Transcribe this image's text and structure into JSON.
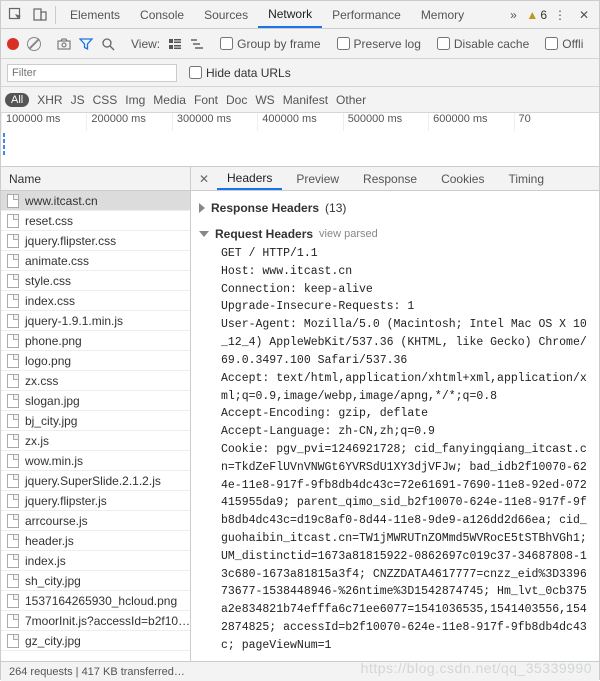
{
  "topTabs": [
    "Elements",
    "Console",
    "Sources",
    "Network",
    "Performance",
    "Memory"
  ],
  "activeTopTab": "Network",
  "warnCount": "6",
  "toolbar2": {
    "viewLabel": "View:",
    "groupByFrame": "Group by frame",
    "preserveLog": "Preserve log",
    "disableCache": "Disable cache",
    "offline": "Offli"
  },
  "filter": {
    "placeholder": "Filter",
    "hideData": "Hide data URLs"
  },
  "typeFilters": {
    "all": "All",
    "items": [
      "XHR",
      "JS",
      "CSS",
      "Img",
      "Media",
      "Font",
      "Doc",
      "WS",
      "Manifest",
      "Other"
    ]
  },
  "timelineTicks": [
    "100000 ms",
    "200000 ms",
    "300000 ms",
    "400000 ms",
    "500000 ms",
    "600000 ms",
    "70"
  ],
  "nameHeader": "Name",
  "files": [
    "www.itcast.cn",
    "reset.css",
    "jquery.flipster.css",
    "animate.css",
    "style.css",
    "index.css",
    "jquery-1.9.1.min.js",
    "phone.png",
    "logo.png",
    "zx.css",
    "slogan.jpg",
    "bj_city.jpg",
    "zx.js",
    "wow.min.js",
    "jquery.SuperSlide.2.1.2.js",
    "jquery.flipster.js",
    "arrcourse.js",
    "header.js",
    "index.js",
    "sh_city.jpg",
    "1537164265930_hcloud.png",
    "7moorInit.js?accessId=b2f10…",
    "gz_city.jpg"
  ],
  "selectedFile": "www.itcast.cn",
  "detailTabs": [
    "Headers",
    "Preview",
    "Response",
    "Cookies",
    "Timing"
  ],
  "activeDetailTab": "Headers",
  "responseHeaders": {
    "title": "Response Headers",
    "count": "(13)"
  },
  "requestHeaders": {
    "title": "Request Headers",
    "viewParsed": "view parsed"
  },
  "headerLines": [
    "GET / HTTP/1.1",
    "Host: www.itcast.cn",
    "Connection: keep-alive",
    "Upgrade-Insecure-Requests: 1",
    "User-Agent: Mozilla/5.0 (Macintosh; Intel Mac OS X 10_12_4) AppleWebKit/537.36 (KHTML, like Gecko) Chrome/69.0.3497.100 Safari/537.36",
    "Accept: text/html,application/xhtml+xml,application/xml;q=0.9,image/webp,image/apng,*/*;q=0.8",
    "Accept-Encoding: gzip, deflate",
    "Accept-Language: zh-CN,zh;q=0.9",
    "Cookie: pgv_pvi=1246921728; cid_fanyingqiang_itcast.cn=TkdZeFlUVnVNWGt6YVRSdU1XY3djVFJw; bad_idb2f10070-624e-11e8-917f-9fb8db4dc43c=72e61691-7690-11e8-92ed-072415955da9; parent_qimo_sid_b2f10070-624e-11e8-917f-9fb8db4dc43c=d19c8af0-8d44-11e8-9de9-a126dd2d66ea; cid_guohaibin_itcast.cn=TW1jMWRUTnZOMmd5WVRocE5tSTBhVGh1; UM_distinctid=1673a81815922-0862697c019c37-34687808-13c680-1673a81815a3f4; CNZZDATA4617777=cnzz_eid%3D339673677-1538448946-%26ntime%3D1542874745; Hm_lvt_0cb375a2e834821b74efffa6c71ee6077=1541036535,1541403556,1542874825; accessId=b2f10070-624e-11e8-917f-9fb8db4dc43c; pageViewNum=1"
  ],
  "statusBar": "264 requests | 417 KB transferred…",
  "watermark": "https://blog.csdn.net/qq_35339990"
}
